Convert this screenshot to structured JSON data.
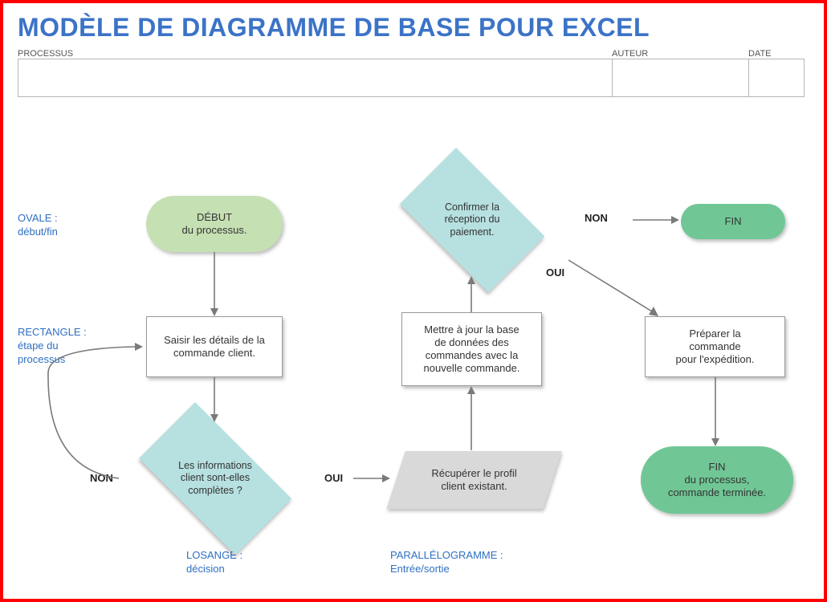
{
  "title": "MODÈLE DE DIAGRAMME DE BASE POUR EXCEL",
  "header": {
    "processus_label": "PROCESSUS",
    "auteur_label": "AUTEUR",
    "date_label": "DATE",
    "processus_value": "",
    "auteur_value": "",
    "date_value": ""
  },
  "legend": {
    "ovale": "OVALE :\ndébut/fin",
    "rectangle": "RECTANGLE :\nétape du\nprocessus",
    "losange": "LOSANGE :\ndécision",
    "parallelogramme": "PARALLÉLOGRAMME :\nEntrée/sortie"
  },
  "labels": {
    "non": "NON",
    "oui": "OUI"
  },
  "nodes": {
    "start": "DÉBUT\ndu processus.",
    "enter_details": "Saisir les détails de la\ncommande client.",
    "info_complete": "Les informations\nclient sont-elles\ncomplètes ?",
    "fetch_profile": "Récupérer le profil\nclient existant.",
    "update_db": "Mettre à jour la base\nde données des\ncommandes avec la\nnouvelle commande.",
    "confirm_payment": "Confirmer la\nréception du\npaiement.",
    "fin_small": "FIN",
    "prepare_ship": "Préparer la\ncommande\npour l'expédition.",
    "fin_big": "FIN\ndu processus,\ncommande terminée."
  },
  "colors": {
    "title": "#3b73c7",
    "legend": "#2f6fc1",
    "oval_start": "#c5e0b3",
    "oval_fin_small": "#70c795",
    "oval_fin_big": "#70c795",
    "diamond": "#b7e0e0",
    "para": "#d9d9d9",
    "arrow": "#7a7a7a"
  }
}
